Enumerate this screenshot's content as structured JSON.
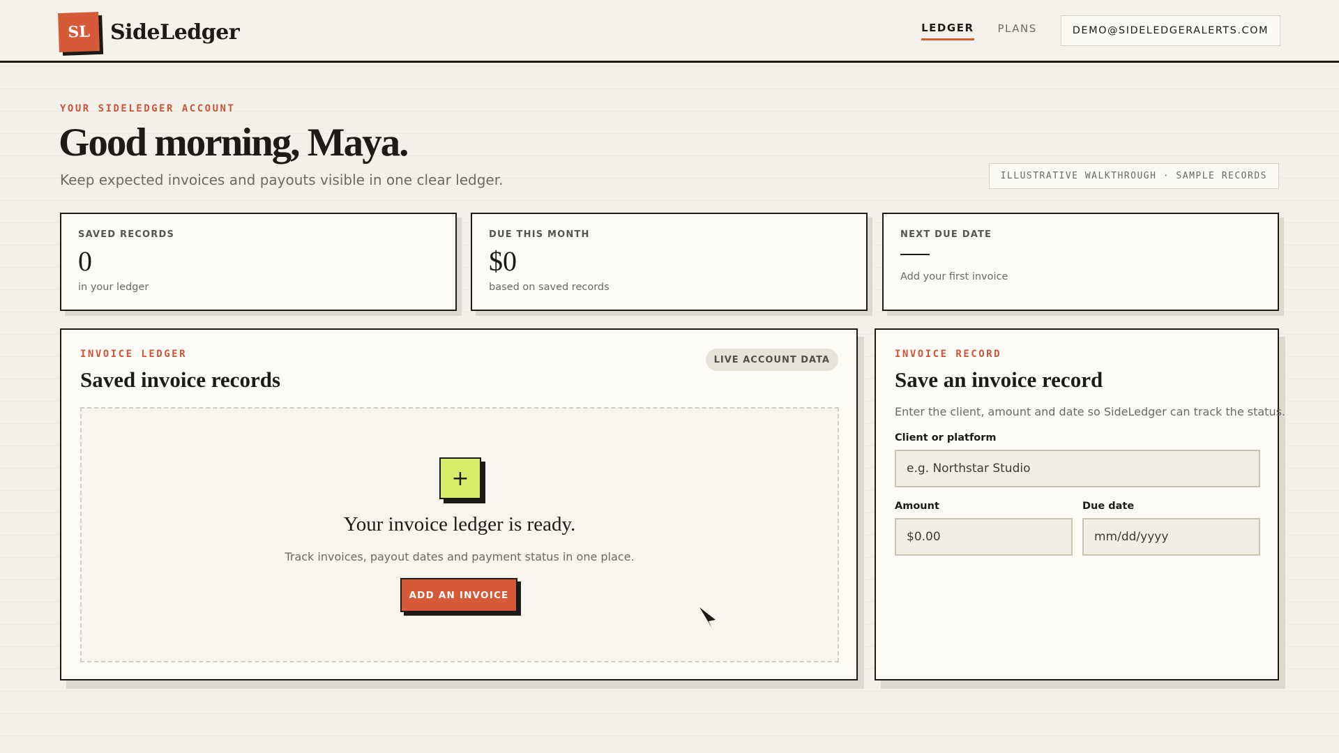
{
  "header": {
    "logo_text": "SL",
    "brand_name": "SideLedger",
    "nav": [
      {
        "label": "LEDGER",
        "active": true
      },
      {
        "label": "PLANS",
        "active": false
      }
    ],
    "account_email": "DEMO@SIDELEDGERALERTS.COM"
  },
  "hero": {
    "eyebrow": "YOUR SIDELEDGER ACCOUNT",
    "greeting": "Good morning, Maya.",
    "subtitle": "Keep expected invoices and payouts visible in one clear ledger.",
    "badge": "ILLUSTRATIVE WALKTHROUGH · SAMPLE RECORDS"
  },
  "stats": [
    {
      "label": "SAVED RECORDS",
      "value": "0",
      "note": "in your ledger"
    },
    {
      "label": "DUE THIS MONTH",
      "value": "$0",
      "note": "based on saved records"
    },
    {
      "label": "NEXT DUE DATE",
      "value": "",
      "note": "Add your first invoice"
    }
  ],
  "ledger": {
    "eyebrow": "INVOICE LEDGER",
    "title": "Saved invoice records",
    "badge": "LIVE ACCOUNT DATA",
    "plus_symbol": "+",
    "empty_title": "Your invoice ledger is ready.",
    "empty_sub": "Track invoices, payout dates and payment status in one place.",
    "add_button": "ADD AN INVOICE"
  },
  "record": {
    "eyebrow": "INVOICE RECORD",
    "title": "Save an invoice record",
    "description": "Enter the client, amount and date so SideLedger can track the status.",
    "client_label": "Client or platform",
    "client_placeholder": "e.g. Northstar Studio",
    "amount_label": "Amount",
    "amount_placeholder": "$0.00",
    "date_label": "Due date",
    "date_placeholder": "mm/dd/yyyy"
  },
  "colors": {
    "accent": "#d65a38",
    "lime": "#d8ee6a",
    "ink": "#1c1b18",
    "paper": "#f2f0e8"
  },
  "icons": {
    "cursor": "mouse-pointer-icon",
    "plus": "plus-icon"
  }
}
